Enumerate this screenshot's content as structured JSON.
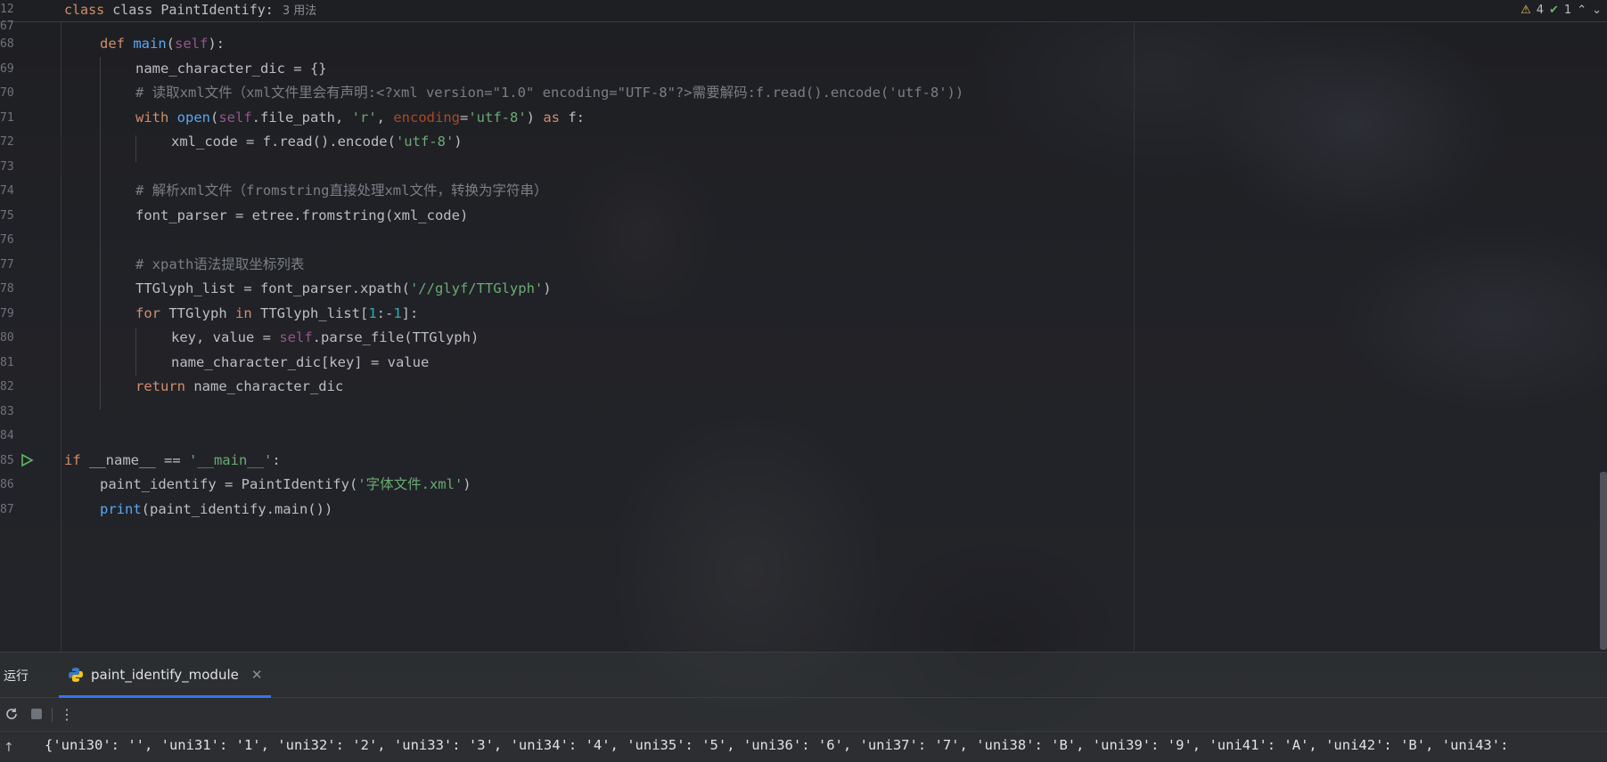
{
  "sticky": {
    "line_no": "12",
    "code": "class PaintIdentify:",
    "usages": "3 用法",
    "next_line_no": "67"
  },
  "inspections": {
    "warnings": "4",
    "checks": "1"
  },
  "code_lines": [
    {
      "no": "68",
      "indent": 1,
      "tokens": [
        {
          "t": "def ",
          "c": "kw"
        },
        {
          "t": "main",
          "c": "fn"
        },
        {
          "t": "(",
          "c": "def"
        },
        {
          "t": "self",
          "c": "self"
        },
        {
          "t": "):",
          "c": "def"
        }
      ]
    },
    {
      "no": "69",
      "indent": 2,
      "tokens": [
        {
          "t": "name_character_dic = {}",
          "c": "def"
        }
      ]
    },
    {
      "no": "70",
      "indent": 2,
      "tokens": [
        {
          "t": "# 读取xml文件（xml文件里会有声明:<?xml version=\"1.0\" encoding=\"UTF-8\"?>需要解码:f.read().encode('utf-8'))",
          "c": "cmt"
        }
      ]
    },
    {
      "no": "71",
      "indent": 2,
      "tokens": [
        {
          "t": "with ",
          "c": "kw"
        },
        {
          "t": "open",
          "c": "fn"
        },
        {
          "t": "(",
          "c": "def"
        },
        {
          "t": "self",
          "c": "self"
        },
        {
          "t": ".file_path, ",
          "c": "def"
        },
        {
          "t": "'r'",
          "c": "str"
        },
        {
          "t": ", ",
          "c": "def"
        },
        {
          "t": "encoding",
          "c": "kwp"
        },
        {
          "t": "=",
          "c": "def"
        },
        {
          "t": "'utf-8'",
          "c": "str"
        },
        {
          "t": ") ",
          "c": "def"
        },
        {
          "t": "as ",
          "c": "kw"
        },
        {
          "t": "f:",
          "c": "def"
        }
      ]
    },
    {
      "no": "72",
      "indent": 3,
      "tokens": [
        {
          "t": "xml_code = f.read().encode(",
          "c": "def"
        },
        {
          "t": "'utf-8'",
          "c": "str"
        },
        {
          "t": ")",
          "c": "def"
        }
      ]
    },
    {
      "no": "73",
      "indent": 0,
      "tokens": []
    },
    {
      "no": "74",
      "indent": 2,
      "tokens": [
        {
          "t": "# 解析xml文件（fromstring直接处理xml文件，转换为字符串）",
          "c": "cmt"
        }
      ]
    },
    {
      "no": "75",
      "indent": 2,
      "tokens": [
        {
          "t": "font_parser = etree.fromstring(xml_code)",
          "c": "def"
        }
      ]
    },
    {
      "no": "76",
      "indent": 0,
      "tokens": []
    },
    {
      "no": "77",
      "indent": 2,
      "tokens": [
        {
          "t": "# xpath语法提取坐标列表",
          "c": "cmt"
        }
      ]
    },
    {
      "no": "78",
      "indent": 2,
      "tokens": [
        {
          "t": "TTGlyph_list = font_parser.xpath(",
          "c": "def"
        },
        {
          "t": "'//glyf/TTGlyph'",
          "c": "str"
        },
        {
          "t": ")",
          "c": "def"
        }
      ]
    },
    {
      "no": "79",
      "indent": 2,
      "tokens": [
        {
          "t": "for ",
          "c": "kw"
        },
        {
          "t": "TTGlyph ",
          "c": "def"
        },
        {
          "t": "in ",
          "c": "kw"
        },
        {
          "t": "TTGlyph_list[",
          "c": "def"
        },
        {
          "t": "1",
          "c": "num"
        },
        {
          "t": ":-",
          "c": "def"
        },
        {
          "t": "1",
          "c": "num"
        },
        {
          "t": "]:",
          "c": "def"
        }
      ]
    },
    {
      "no": "80",
      "indent": 3,
      "tokens": [
        {
          "t": "key, value = ",
          "c": "def"
        },
        {
          "t": "self",
          "c": "self"
        },
        {
          "t": ".parse_file(TTGlyph)",
          "c": "def"
        }
      ]
    },
    {
      "no": "81",
      "indent": 3,
      "tokens": [
        {
          "t": "name_character_dic[key] = value",
          "c": "def"
        }
      ]
    },
    {
      "no": "82",
      "indent": 2,
      "tokens": [
        {
          "t": "return ",
          "c": "kw"
        },
        {
          "t": "name_character_dic",
          "c": "def"
        }
      ]
    },
    {
      "no": "83",
      "indent": 0,
      "tokens": []
    },
    {
      "no": "84",
      "indent": 0,
      "tokens": []
    },
    {
      "no": "85",
      "indent": 0,
      "run": true,
      "tokens": [
        {
          "t": "if ",
          "c": "kw"
        },
        {
          "t": "__name__ == ",
          "c": "def"
        },
        {
          "t": "'__main__'",
          "c": "str"
        },
        {
          "t": ":",
          "c": "def"
        }
      ]
    },
    {
      "no": "86",
      "indent": 1,
      "tokens": [
        {
          "t": "paint_identify = PaintIdentify(",
          "c": "def"
        },
        {
          "t": "'字体文件.xml'",
          "c": "str"
        },
        {
          "t": ")",
          "c": "def"
        }
      ]
    },
    {
      "no": "87",
      "indent": 1,
      "tokens": [
        {
          "t": "print",
          "c": "fn"
        },
        {
          "t": "(paint_identify.main())",
          "c": "def"
        }
      ]
    }
  ],
  "toolwindow": {
    "run_label": "运行",
    "tab_label": "paint_identify_module",
    "output": "{'uni30': '', 'uni31': '1', 'uni32': '2', 'uni33': '3', 'uni34': '4', 'uni35': '5', 'uni36': '6', 'uni37': '7', 'uni38': 'B', 'uni39': '9', 'uni41': 'A', 'uni42': 'B', 'uni43':"
  },
  "icons": {
    "warning": "warning-icon",
    "check": "check-icon",
    "run": "run-icon",
    "rerun": "rerun-icon",
    "stop": "stop-icon",
    "more": "more-icon",
    "python": "python-icon"
  }
}
